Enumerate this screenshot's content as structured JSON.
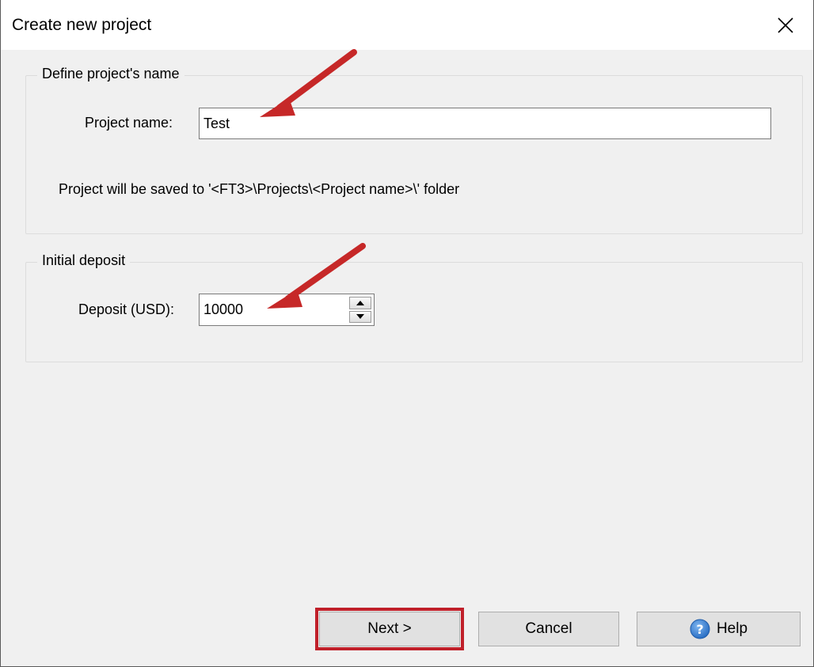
{
  "window": {
    "title": "Create new project"
  },
  "name_group": {
    "legend": "Define project's name",
    "project_name_label": "Project name:",
    "project_name_value": "Test",
    "save_hint": "Project will be saved to '<FT3>\\Projects\\<Project name>\\' folder"
  },
  "deposit_group": {
    "legend": "Initial deposit",
    "deposit_label": "Deposit (USD):",
    "deposit_value": "10000"
  },
  "buttons": {
    "next": "Next >",
    "cancel": "Cancel",
    "help": "Help"
  },
  "colors": {
    "annotation_arrow": "#c62828",
    "highlight_outline": "#c0202a",
    "help_icon": "#2f7bd6"
  },
  "icons": [
    "close-icon",
    "spin-up-icon",
    "spin-down-icon",
    "help-icon",
    "annotation-arrow"
  ]
}
